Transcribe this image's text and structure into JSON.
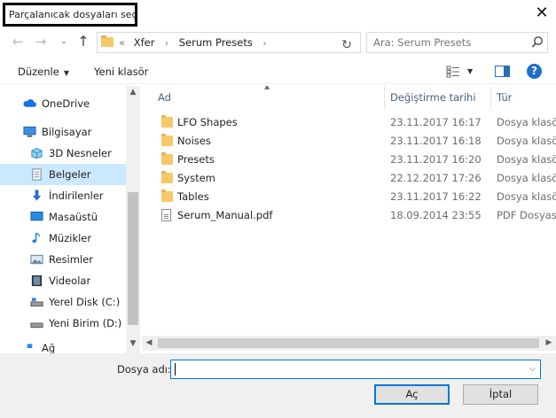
{
  "window": {
    "title": "Parçalanıcak dosyaları seç",
    "close_label": "✕"
  },
  "nav": {
    "back": "←",
    "forward": "→",
    "recent": "⌄",
    "up": "↑",
    "address_lead": "«",
    "breadcrumbs": [
      "Xfer",
      "Serum Presets"
    ],
    "crumb_sep": "›",
    "refresh": "↻",
    "search_placeholder": "Ara: Serum Presets"
  },
  "toolbar": {
    "organize": "Düzenle",
    "new_folder": "Yeni klasör",
    "help": "?"
  },
  "sidebar": {
    "items": [
      {
        "label": "OneDrive",
        "icon": "cloud-icon",
        "color": "#1473e6",
        "indent": 0
      },
      {
        "label": "Bilgisayar",
        "icon": "computer-icon",
        "color": "#3a8ee6",
        "indent": 0
      },
      {
        "label": "3D Nesneler",
        "icon": "cube-icon",
        "color": "#35a8d8",
        "indent": 1
      },
      {
        "label": "Belgeler",
        "icon": "document-icon",
        "color": "#7a8fa6",
        "indent": 1,
        "selected": true
      },
      {
        "label": "İndirilenler",
        "icon": "download-icon",
        "color": "#2a6fd6",
        "indent": 1
      },
      {
        "label": "Masaüstü",
        "icon": "desktop-icon",
        "color": "#2a8ae0",
        "indent": 1
      },
      {
        "label": "Müzikler",
        "icon": "music-icon",
        "color": "#1f7ad6",
        "indent": 1
      },
      {
        "label": "Resimler",
        "icon": "pictures-icon",
        "color": "#5a7a9a",
        "indent": 1
      },
      {
        "label": "Videolar",
        "icon": "video-icon",
        "color": "#333333",
        "indent": 1
      },
      {
        "label": "Yerel Disk (C:)",
        "icon": "drive-c-icon",
        "color": "#666666",
        "indent": 1
      },
      {
        "label": "Yeni Birim (D:)",
        "icon": "drive-d-icon",
        "color": "#666666",
        "indent": 1
      }
    ],
    "cut_off_label": "Ağ"
  },
  "columns": {
    "name": "Ad",
    "date": "Değiştirme tarihi",
    "type": "Tür"
  },
  "files": [
    {
      "name": "LFO Shapes",
      "date": "23.11.2017 16:17",
      "type": "Dosya klasörü",
      "kind": "folder"
    },
    {
      "name": "Noises",
      "date": "23.11.2017 16:18",
      "type": "Dosya klasörü",
      "kind": "folder"
    },
    {
      "name": "Presets",
      "date": "23.11.2017 16:20",
      "type": "Dosya klasörü",
      "kind": "folder"
    },
    {
      "name": "System",
      "date": "22.12.2017 17:26",
      "type": "Dosya klasörü",
      "kind": "folder"
    },
    {
      "name": "Tables",
      "date": "23.11.2017 16:22",
      "type": "Dosya klasörü",
      "kind": "folder"
    },
    {
      "name": "Serum_Manual.pdf",
      "date": "18.09.2014 23:55",
      "type": "PDF Dosyası",
      "kind": "pdf"
    }
  ],
  "footer": {
    "filename_label": "Dosya adı:",
    "filename_value": "",
    "open_button": "Aç",
    "cancel_button": "İptal"
  },
  "colors": {
    "accent": "#0078d7",
    "selection": "#cce8ff",
    "folder": "#f5c86a"
  }
}
